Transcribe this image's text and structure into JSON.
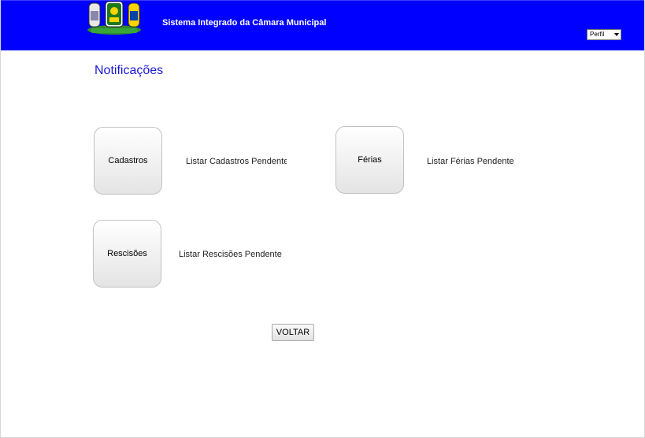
{
  "header": {
    "system_title": "Sistema Integrado da Câmara Municipal",
    "profile_select": {
      "selected": "Perfil"
    },
    "bg_color": "#0000fe"
  },
  "page": {
    "title": "Notificações"
  },
  "tiles": [
    {
      "label": "Cadastros",
      "link": "Listar Cadastros Pendentes"
    },
    {
      "label": "Férias",
      "link": "Listar Férias Pendentes"
    },
    {
      "label": "Rescisões",
      "link": "Listar Rescisões Pendentes"
    }
  ],
  "actions": {
    "back_label": "VOLTAR"
  }
}
